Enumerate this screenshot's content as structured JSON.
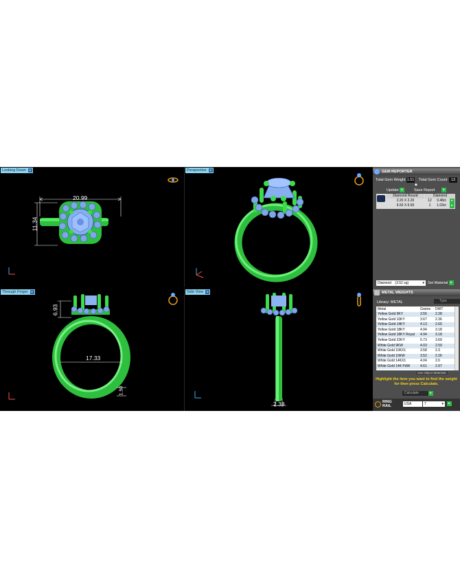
{
  "viewports": {
    "top_left": {
      "label": "Looking Down",
      "width_dim": "20.99",
      "height_dim": "11.34"
    },
    "top_right": {
      "label": "Perspective"
    },
    "bottom_left": {
      "label": "Through Finger",
      "height_dim": "6.93",
      "inner_dim": "17.33",
      "shank_dim": "1.50"
    },
    "bottom_right": {
      "label": "Side View",
      "width_dim": "2.38"
    }
  },
  "gem_reporter": {
    "title": "GEM REPORTER",
    "total_weight_label": "Total Gem Weight",
    "total_weight_value": "1.51",
    "total_count_label": "Total Gem Count",
    "total_count_value": "13",
    "update_label": "Update",
    "save_report_label": "Save Report",
    "table_headers": [
      "Diamond Round",
      "Diamond"
    ],
    "rows": [
      {
        "size": "2.20 X 2.20",
        "count": "12",
        "weight": "0.48ct"
      },
      {
        "size": "6.50 X 6.50",
        "count": "1",
        "weight": "1.03ct"
      }
    ],
    "material_select": "Diamond",
    "material_sg": "(3.52 sg)",
    "set_material_label": "Set Material"
  },
  "metal_weights": {
    "title": "METAL WEIGHTS",
    "library_label": "Library: METAL",
    "search_value": "Type",
    "columns": [
      "Metal",
      "Grams",
      "DWT"
    ],
    "rows": [
      {
        "metal": "Yellow Gold 9KY",
        "grams": "3.55",
        "dwt": "2.28"
      },
      {
        "metal": "Yellow Gold 10KY",
        "grams": "3.67",
        "dwt": "2.36"
      },
      {
        "metal": "Yellow Gold 14KY",
        "grams": "4.13",
        "dwt": "2.65"
      },
      {
        "metal": "Yellow Gold 18KY",
        "grams": "4.94",
        "dwt": "3.18"
      },
      {
        "metal": "Yellow Gold 18KY Royal",
        "grams": "4.94",
        "dwt": "3.18"
      },
      {
        "metal": "Yellow Gold 22KY",
        "grams": "5.73",
        "dwt": "3.69"
      },
      {
        "metal": "White Gold 9KW",
        "grams": "4.03",
        "dwt": "2.59"
      },
      {
        "metal": "White Gold 10KX1",
        "grams": "3.58",
        "dwt": "2.3"
      },
      {
        "metal": "White Gold 10KW",
        "grams": "3.52",
        "dwt": "2.26"
      },
      {
        "metal": "White Gold 14KX1",
        "grams": "4.04",
        "dwt": "2.6"
      },
      {
        "metal": "White Gold 14K PdW",
        "grams": "4.61",
        "dwt": "2.97"
      }
    ],
    "use_object_label": "Use Object Materials",
    "note": "Highlight the item you want to find the weight for then press Calculate.",
    "calculate_label": "Calculate"
  },
  "ring_rail": {
    "label": "RING RAIL",
    "region": "USA",
    "size": "7"
  },
  "colors": {
    "ring_green": "#3ddc4c",
    "gem_blue": "#7fa6e6",
    "tab_blue": "#8fd4ef",
    "panel_gray": "#4e4e4e",
    "note_yellow": "#f7d411"
  }
}
